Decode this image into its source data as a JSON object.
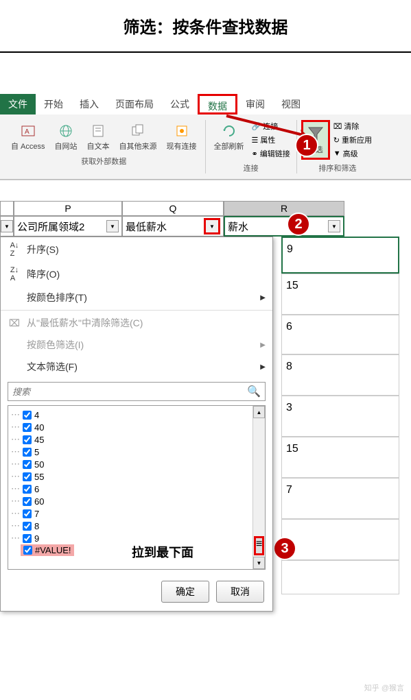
{
  "title": "筛选：按条件查找数据",
  "ribbon": {
    "tabs": {
      "file": "文件",
      "home": "开始",
      "insert": "插入",
      "page_layout": "页面布局",
      "formulas": "公式",
      "data": "数据",
      "review": "审阅",
      "view": "视图"
    },
    "buttons": {
      "from_access": "自 Access",
      "from_web": "自网站",
      "from_text": "自文本",
      "from_other": "自其他来源",
      "existing": "现有连接",
      "refresh_all": "全部刷新",
      "connections": "连接",
      "properties": "属性",
      "edit_links": "编辑链接",
      "filter": "筛选",
      "clear": "清除",
      "reapply": "重新应用",
      "advanced": "高级"
    },
    "groups": {
      "external_data": "获取外部数据",
      "connections": "连接",
      "sort_filter": "排序和筛选"
    }
  },
  "columns": {
    "p": "P",
    "q": "Q",
    "r": "R",
    "p_header": "公司所属领域2",
    "q_header": "最低薪水",
    "r_header": "薪水"
  },
  "filter_menu": {
    "sort_asc": "升序(S)",
    "sort_desc": "降序(O)",
    "sort_color": "按颜色排序(T)",
    "clear_filter": "从\"最低薪水\"中清除筛选(C)",
    "filter_color": "按颜色筛选(I)",
    "text_filter": "文本筛选(F)",
    "search_placeholder": "搜索",
    "ok": "确定",
    "cancel": "取消"
  },
  "checkbox_values": [
    "4",
    "40",
    "45",
    "5",
    "50",
    "55",
    "6",
    "60",
    "7",
    "8",
    "9",
    "#VALUE!"
  ],
  "data_values": [
    "9",
    "15",
    "6",
    "8",
    "3",
    "15",
    "7"
  ],
  "annotations": {
    "callout_1": "1",
    "callout_2": "2",
    "callout_3": "3",
    "scroll_text": "拉到最下面"
  },
  "watermark": "知乎 @猴言"
}
